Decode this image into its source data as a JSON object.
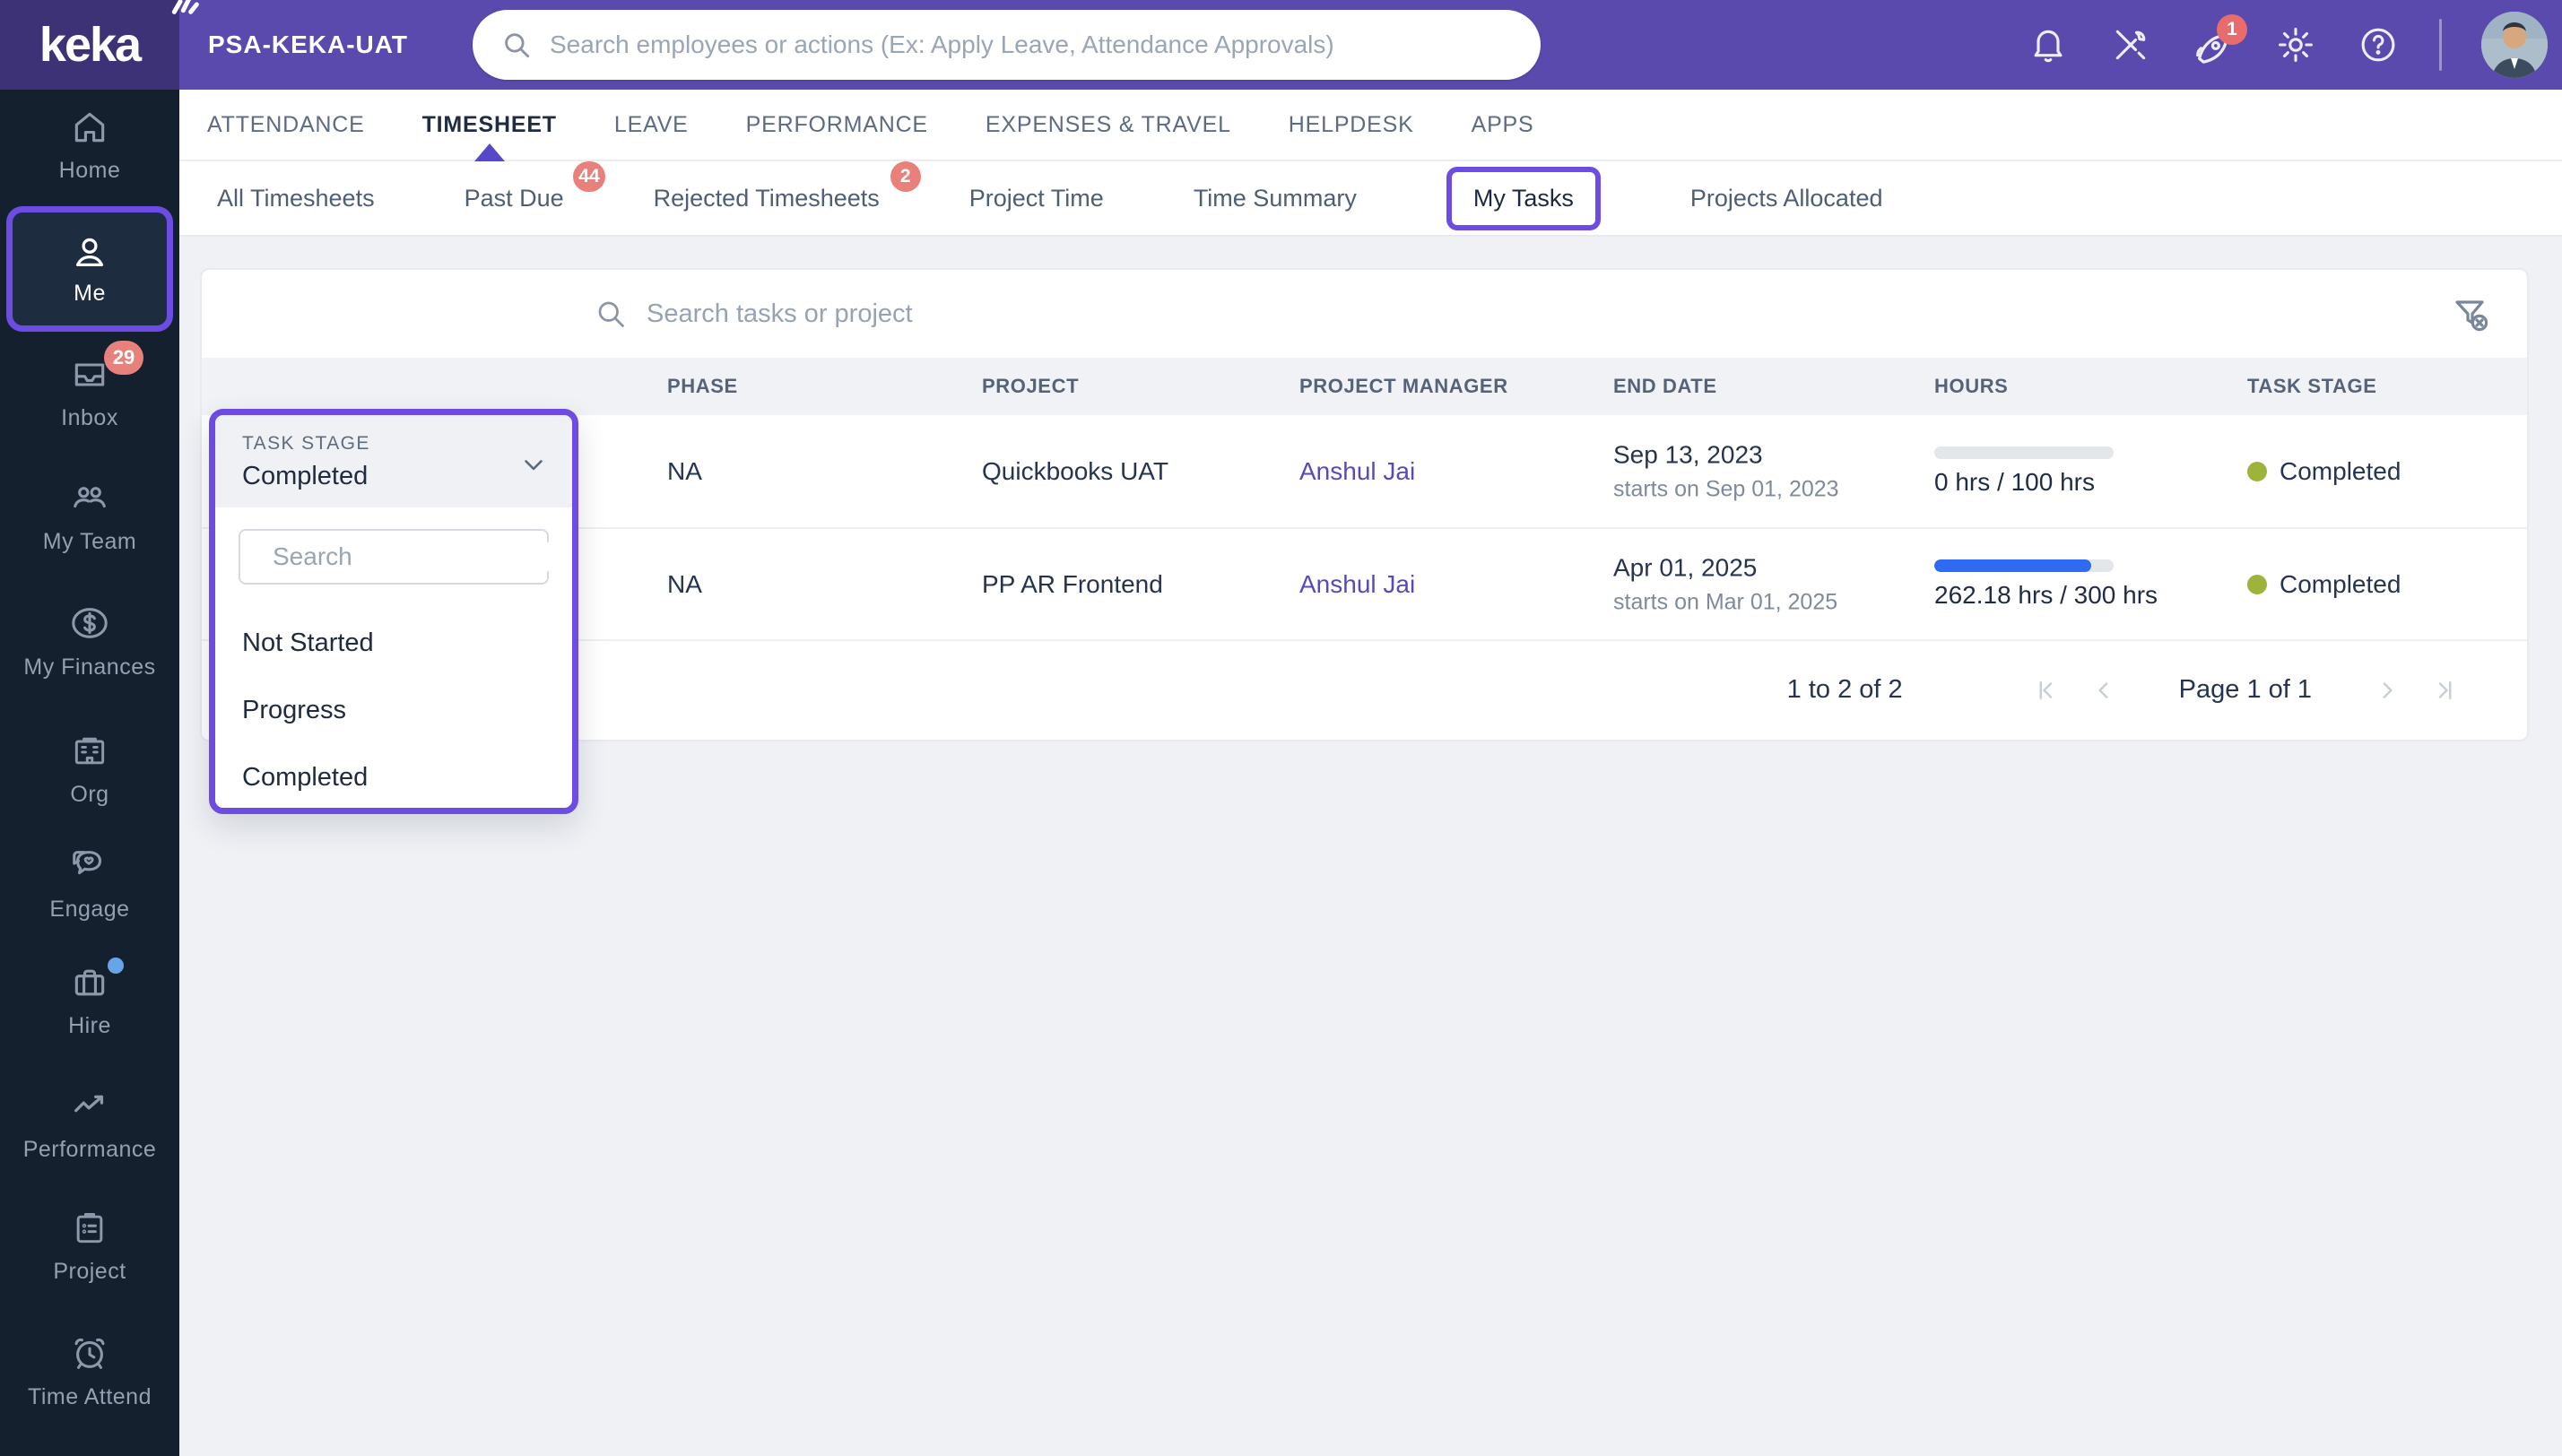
{
  "header": {
    "logo_text": "keka",
    "env_name": "PSA-KEKA-UAT",
    "search_placeholder": "Search employees or actions (Ex: Apply Leave, Attendance Approvals)",
    "announcement_badge": "1"
  },
  "nav_tabs": [
    {
      "label": "ATTENDANCE",
      "active": false
    },
    {
      "label": "TIMESHEET",
      "active": true
    },
    {
      "label": "LEAVE",
      "active": false
    },
    {
      "label": "PERFORMANCE",
      "active": false
    },
    {
      "label": "EXPENSES & TRAVEL",
      "active": false
    },
    {
      "label": "HELPDESK",
      "active": false
    },
    {
      "label": "APPS",
      "active": false
    }
  ],
  "sub_tabs": [
    {
      "label": "All Timesheets"
    },
    {
      "label": "Past Due",
      "badge": "44"
    },
    {
      "label": "Rejected Timesheets",
      "badge": "2"
    },
    {
      "label": "Project Time"
    },
    {
      "label": "Time Summary"
    },
    {
      "label": "My Tasks",
      "highlighted": true
    },
    {
      "label": "Projects Allocated"
    }
  ],
  "sidebar": {
    "items": [
      {
        "label": "Home",
        "icon": "home-icon"
      },
      {
        "label": "Me",
        "icon": "user-icon",
        "active": true
      },
      {
        "label": "Inbox",
        "icon": "inbox-icon",
        "badge": "29"
      },
      {
        "label": "My Team",
        "icon": "team-icon"
      },
      {
        "label": "My Finances",
        "icon": "dollar-icon"
      },
      {
        "label": "Org",
        "icon": "building-icon"
      },
      {
        "label": "Engage",
        "icon": "chat-heart-icon"
      },
      {
        "label": "Hire",
        "icon": "briefcase-icon",
        "dot": true
      },
      {
        "label": "Performance",
        "icon": "trend-up-icon"
      },
      {
        "label": "Project",
        "icon": "clipboard-icon"
      },
      {
        "label": "Time Attend",
        "icon": "alarm-clock-icon"
      }
    ]
  },
  "task_stage_dropdown": {
    "label": "TASK STAGE",
    "selected_value": "Completed",
    "search_placeholder": "Search",
    "options": [
      "Not Started",
      "Progress",
      "Completed"
    ]
  },
  "tasks_panel": {
    "search_placeholder": "Search tasks or project",
    "columns": [
      "PHASE",
      "PROJECT",
      "PROJECT MANAGER",
      "END DATE",
      "HOURS",
      "TASK STAGE"
    ],
    "rows": [
      {
        "phase": "NA",
        "project": "Quickbooks UAT",
        "project_manager": "Anshul Jai",
        "end_date": "Sep 13, 2023",
        "start_note": "starts on Sep 01, 2023",
        "hours_text": "0 hrs / 100 hrs",
        "progress_pct": 0,
        "task_stage": "Completed"
      },
      {
        "phase": "NA",
        "project": "PP AR Frontend",
        "project_manager": "Anshul Jai",
        "end_date": "Apr 01, 2025",
        "start_note": "starts on Mar 01, 2025",
        "hours_text": "262.18 hrs / 300 hrs",
        "progress_pct": 87.4,
        "task_stage": "Completed"
      }
    ],
    "pagination": {
      "range_text": "1 to 2 of 2",
      "page_text": "Page 1 of 1"
    }
  },
  "colors": {
    "header_purple": "#5b4aad",
    "logo_purple": "#3e3277",
    "sidebar_navy": "#15202f",
    "annotation_purple": "#6d4ce3",
    "badge_red": "#e8807c",
    "progress_blue": "#2e6bf2",
    "stage_dot_green": "#9cb43c",
    "link_indigo": "#584bb8"
  }
}
